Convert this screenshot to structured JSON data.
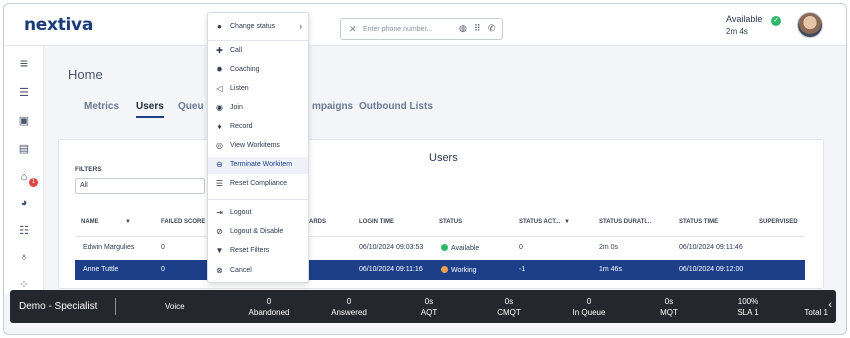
{
  "app": {
    "logo": "nextiva"
  },
  "header": {
    "phone_placeholder": "Enter phone number...",
    "status": "Available",
    "timer": "2m 4s"
  },
  "page": {
    "title": "Home",
    "tabs": [
      "Metrics",
      "Users",
      "Queu",
      "mpaigns",
      "Outbound Lists"
    ],
    "active_tab": "Users"
  },
  "panel": {
    "title": "Users",
    "filters_label": "FILTERS",
    "filter_value": "All",
    "columns": [
      "NAME",
      "FAILED SCORE",
      "ARDS",
      "LOGIN TIME",
      "STATUS",
      "STATUS ACT...",
      "STATUS DURATI...",
      "STATUS TIME",
      "SUPERVISED"
    ],
    "rows": [
      {
        "name": "Edwin Margulies",
        "failed": "0",
        "login": "06/10/2024 09:03:53",
        "status": "Available",
        "status_act": "0",
        "duration": "2m 0s",
        "status_time": "06/10/2024 09:11:46",
        "status_color": "#2fb86a"
      },
      {
        "name": "Anne Tuttle",
        "failed": "0",
        "login": "06/10/2024 09:11:16",
        "status": "Working",
        "status_act": "-1",
        "duration": "1m 46s",
        "status_time": "06/10/2024 09:12:00",
        "status_color": "#f0a04b"
      }
    ]
  },
  "context_menu": {
    "items": [
      {
        "label": "Change status",
        "icon": "person-icon",
        "submenu": true
      },
      {
        "label": "Call",
        "icon": "add-call-icon"
      },
      {
        "label": "Coaching",
        "icon": "gear-icon"
      },
      {
        "label": "Listen",
        "icon": "speaker-icon"
      },
      {
        "label": "Join",
        "icon": "join-icon"
      },
      {
        "label": "Record",
        "icon": "mic-icon"
      },
      {
        "label": "View Workitems",
        "icon": "eye-icon"
      },
      {
        "label": "Terminate Workitem",
        "icon": "minus-circle-icon",
        "highlight": true
      },
      {
        "label": "Reset Compliance",
        "icon": "sliders-icon"
      },
      {
        "label": "Logout",
        "icon": "logout-icon"
      },
      {
        "label": "Logout & Disable",
        "icon": "logout-disable-icon"
      },
      {
        "label": "Reset Filters",
        "icon": "filter-reset-icon"
      },
      {
        "label": "Cancel",
        "icon": "x-circle-icon"
      }
    ]
  },
  "bottom_bar": {
    "title": "Demo - Specialist",
    "channel": "Voice",
    "stats": [
      {
        "value": "0",
        "label": "Abandoned"
      },
      {
        "value": "0",
        "label": "Answered"
      },
      {
        "value": "0s",
        "label": "AQT"
      },
      {
        "value": "0s",
        "label": "CMQT"
      },
      {
        "value": "0",
        "label": "In Queue"
      },
      {
        "value": "0s",
        "label": "MQT"
      },
      {
        "value": "100%",
        "label": "SLA 1"
      },
      {
        "value": "",
        "label": "Total 1"
      }
    ]
  },
  "sidebar": {
    "notification_count": "1"
  }
}
